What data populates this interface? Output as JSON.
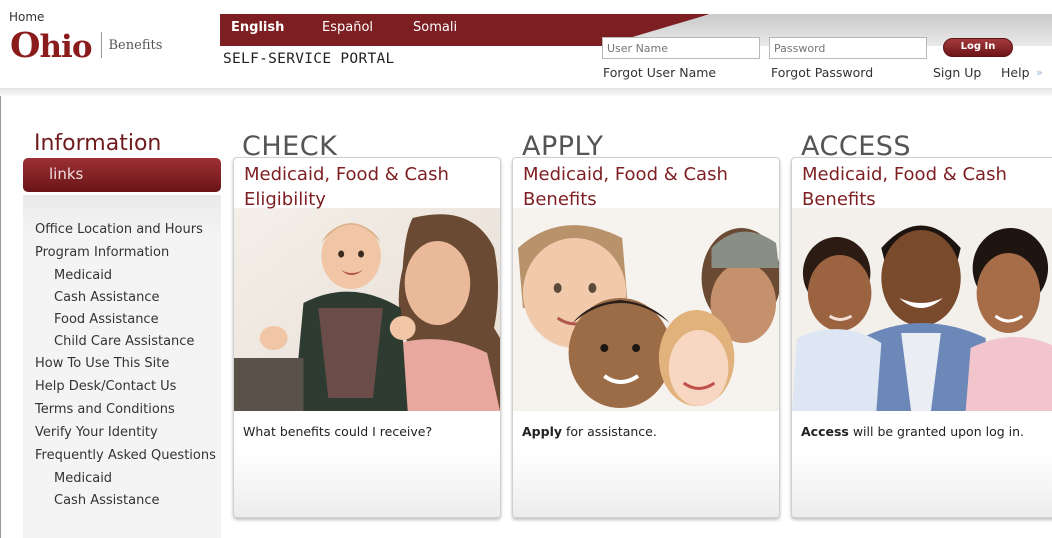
{
  "header": {
    "home_link": "Home",
    "logo_ohio": "hio",
    "logo_o": "O",
    "logo_benefits": "Benefits",
    "portal_title": "SELF-SERVICE PORTAL",
    "languages": [
      "English",
      "Español",
      "Somali"
    ],
    "active_language": "English",
    "username_placeholder": "User Name",
    "password_placeholder": "Password",
    "login_button": "Log In",
    "forgot_username": "Forgot User Name",
    "forgot_password": "Forgot Password",
    "sign_up": "Sign Up",
    "help": "Help",
    "help_arrow": "»",
    "brand_color": "#7d1f22"
  },
  "sidebar": {
    "title": "Information",
    "links_label": "links",
    "items": [
      {
        "label": "Office Location and Hours",
        "sub": false
      },
      {
        "label": "Program Information",
        "sub": false
      },
      {
        "label": "Medicaid",
        "sub": true
      },
      {
        "label": "Cash Assistance",
        "sub": true
      },
      {
        "label": "Food Assistance",
        "sub": true
      },
      {
        "label": "Child Care Assistance",
        "sub": true
      },
      {
        "label": "How To Use This Site",
        "sub": false
      },
      {
        "label": "Help Desk/Contact Us",
        "sub": false
      },
      {
        "label": "Terms and Conditions",
        "sub": false
      },
      {
        "label": "Verify Your Identity",
        "sub": false
      },
      {
        "label": "Frequently Asked Questions",
        "sub": false
      },
      {
        "label": "Medicaid",
        "sub": true
      },
      {
        "label": "Cash Assistance",
        "sub": true
      }
    ]
  },
  "cards": [
    {
      "heading": "CHECK",
      "subtitle": "Medicaid, Food & Cash Eligibility",
      "image": "mother-and-baby-photo",
      "text_bold": "",
      "text": "What benefits could I receive?"
    },
    {
      "heading": "APPLY",
      "subtitle": "Medicaid, Food & Cash Benefits",
      "image": "group-of-children-photo",
      "text_bold": "Apply",
      "text": " for assistance."
    },
    {
      "heading": "ACCESS",
      "subtitle": "Medicaid, Food & Cash Benefits",
      "image": "father-with-two-children-photo",
      "text_bold": "Access",
      "text": " will be granted upon log in."
    }
  ]
}
